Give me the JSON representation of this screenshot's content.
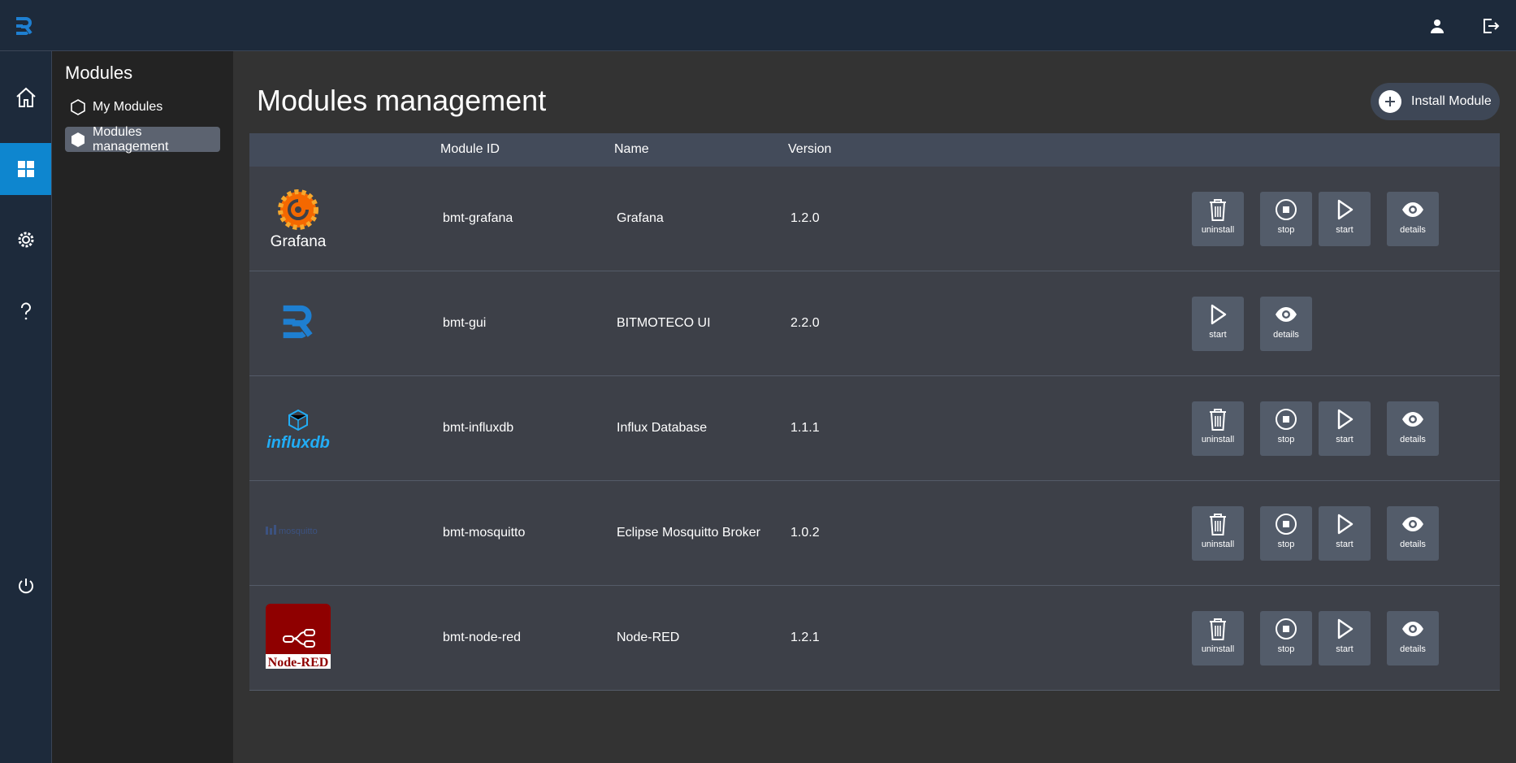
{
  "topbar": {
    "logo_icon": "bitmoteco-logo-icon",
    "user_icon": "user-icon",
    "logout_icon": "logout-icon"
  },
  "rail": [
    {
      "icon": "home-icon"
    },
    {
      "icon": "modules-grid-icon",
      "active": true
    },
    {
      "icon": "settings-gear-icon"
    },
    {
      "icon": "help-icon"
    },
    {
      "icon": "power-icon"
    }
  ],
  "sidebar": {
    "title": "Modules",
    "items": [
      {
        "label": "My Modules",
        "icon": "hexagon-outline-icon"
      },
      {
        "label": "Modules management",
        "icon": "hexagon-filled-icon",
        "active": true
      }
    ]
  },
  "main": {
    "title": "Modules management",
    "install_label": "Install Module",
    "columns": {
      "id": "Module ID",
      "name": "Name",
      "version": "Version"
    },
    "rows": [
      {
        "id": "bmt-grafana",
        "name": "Grafana",
        "version": "1.2.0",
        "logo": "grafana-logo",
        "logo_text": "Grafana",
        "actions": [
          "uninstall",
          "stop",
          "start",
          "details"
        ]
      },
      {
        "id": "bmt-gui",
        "name": "BITMOTECO UI",
        "version": "2.2.0",
        "logo": "bitmoteco-logo",
        "logo_text": "",
        "actions": [
          "start",
          "details"
        ]
      },
      {
        "id": "bmt-influxdb",
        "name": "Influx Database",
        "version": "1.1.1",
        "logo": "influxdb-logo",
        "logo_text": "influxdb",
        "actions": [
          "uninstall",
          "stop",
          "start",
          "details"
        ]
      },
      {
        "id": "bmt-mosquitto",
        "name": "Eclipse Mosquitto Broker",
        "version": "1.0.2",
        "logo": "mosquitto-logo",
        "logo_text": "mosquitto",
        "actions": [
          "uninstall",
          "stop",
          "start",
          "details"
        ]
      },
      {
        "id": "bmt-node-red",
        "name": "Node-RED",
        "version": "1.2.1",
        "logo": "node-red-logo",
        "logo_text": "Node-RED",
        "actions": [
          "uninstall",
          "stop",
          "start",
          "details"
        ]
      }
    ],
    "action_labels": {
      "uninstall": "uninstall",
      "stop": "stop",
      "start": "start",
      "details": "details"
    }
  },
  "colors": {
    "accent": "#0e86cf",
    "topbar": "#1d2a3b",
    "row_bg": "#3d4048",
    "header_bg": "#434b5a",
    "button_bg": "#535c6a"
  }
}
